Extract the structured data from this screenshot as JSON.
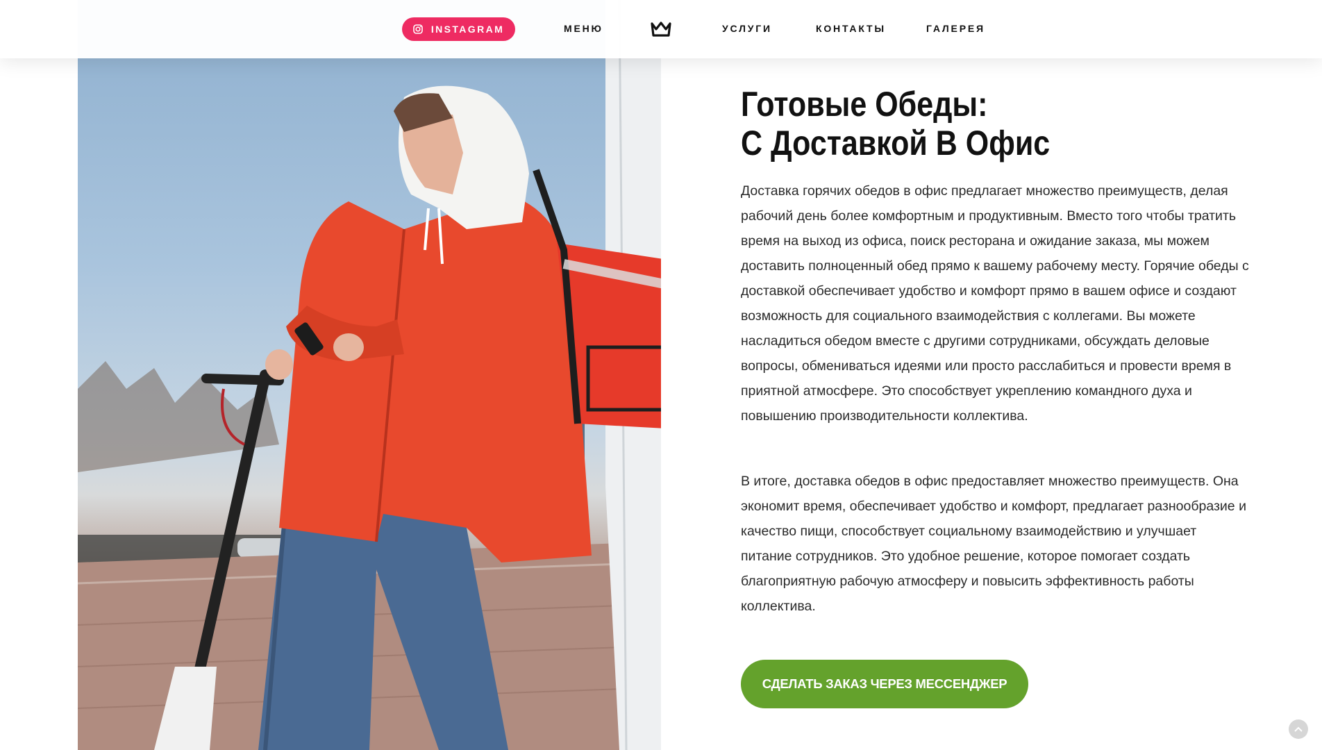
{
  "header": {
    "instagram_label": "INSTAGRAM",
    "nav": {
      "menu": "МЕНЮ",
      "services": "УСЛУГИ",
      "contacts": "КОНТАКТЫ",
      "gallery": "ГАЛЕРЕЯ"
    },
    "logo_icon": "crown-icon"
  },
  "article": {
    "title_line1": "Готовые Обеды:",
    "title_line2": "С Доставкой В Офис",
    "paragraph1": "Доставка горячих обедов в офис предлагает множество преимуществ, делая рабочий день более комфортным и продуктивным. Вместо того чтобы тратить время на выход из офиса, поиск ресторана и ожидание заказа, мы можем доставить полноценный обед прямо к вашему рабочему месту. Горячие обеды с доставкой обеспечивает удобство и комфорт прямо в вашем офисе и создают возможность для социального взаимодействия с коллегами. Вы можете насладиться обедом вместе с другими сотрудниками, обсуждать деловые вопросы, обмениваться идеями или просто расслабиться и провести время в приятной атмосфере. Это способствует укреплению командного духа и повышению производительности коллектива.",
    "paragraph2": "В итоге, доставка обедов в офис предоставляет множество преимуществ. Она экономит время, обеспечивает удобство и комфорт, предлагает разнообразие и качество пищи, способствует социальному взаимодействию и улучшает питание сотрудников. Это удобное решение, которое помогает создать благоприятную рабочую атмосферу и повысить эффективность работы коллектива.",
    "order_button": "СДЕЛАТЬ ЗАКАЗ ЧЕРЕЗ МЕССЕНДЖЕР"
  },
  "colors": {
    "instagram": "#ee2b62",
    "order_button": "#64a22c",
    "jacket": "#e8492d"
  },
  "icons": {
    "instagram": "instagram-icon",
    "scroll_top": "chevron-up-icon"
  }
}
